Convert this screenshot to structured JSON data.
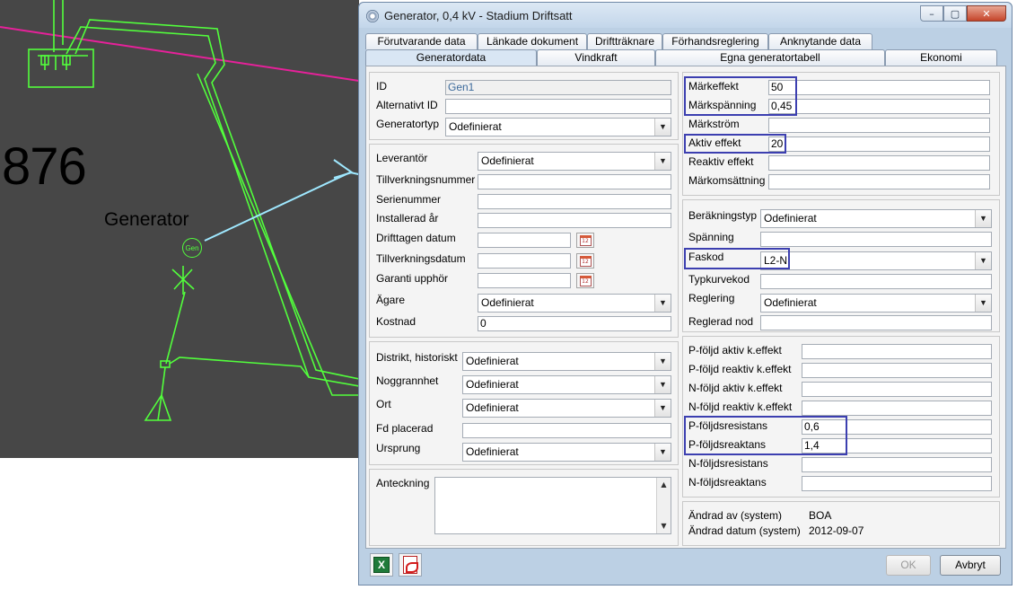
{
  "cad": {
    "number": "876",
    "generator_label": "Generator",
    "gen_symbol": "Gen"
  },
  "window": {
    "title": "Generator, 0,4 kV - Stadium Driftsatt",
    "buttons": {
      "minimize": "–",
      "maximize": "▢",
      "close": "✕"
    }
  },
  "tabs": {
    "row1": [
      "Förutvarande data",
      "Länkade dokument",
      "Driftträknare",
      "Förhandsreglering",
      "Anknytande data"
    ],
    "row2": [
      "Generatordata",
      "Vindkraft",
      "Egna generatortabell",
      "Ekonomi"
    ]
  },
  "ident": {
    "id_label": "ID",
    "id_value": "Gen1",
    "alt_id_label": "Alternativt ID",
    "alt_id_value": "",
    "type_label": "Generatortyp",
    "type_value": "Odefinierat"
  },
  "supplier": {
    "leverantor_label": "Leverantör",
    "leverantor_value": "Odefinierat",
    "tillv_nr_label": "Tillverkningsnummer",
    "tillv_nr_value": "",
    "serienummer_label": "Serienummer",
    "serienummer_value": "",
    "installerad_label": "Installerad år",
    "installerad_value": "",
    "drifttagen_label": "Drifttagen datum",
    "drifttagen_value": "",
    "tillv_datum_label": "Tillverkningsdatum",
    "tillv_datum_value": "",
    "garanti_label": "Garanti upphör",
    "garanti_value": "",
    "agare_label": "Ägare",
    "agare_value": "Odefinierat",
    "kostnad_label": "Kostnad",
    "kostnad_value": "0",
    "calendar_icon_text": "12"
  },
  "location": {
    "distrikt_label": "Distrikt, historiskt",
    "distrikt_value": "Odefinierat",
    "noggrannhet_label": "Noggrannhet",
    "noggrannhet_value": "Odefinierat",
    "ort_label": "Ort",
    "ort_value": "Odefinierat",
    "fd_placerad_label": "Fd placerad",
    "fd_placerad_value": "",
    "ursprung_label": "Ursprung",
    "ursprung_value": "Odefinierat"
  },
  "notes": {
    "label": "Anteckning",
    "value": ""
  },
  "rating": {
    "markeffekt_label": "Märkeffekt",
    "markeffekt_value": "50",
    "markspanning_label": "Märkspänning",
    "markspanning_value": "0,45",
    "markstrom_label": "Märkström",
    "markstrom_value": "",
    "aktiv_label": "Aktiv effekt",
    "aktiv_value": "20",
    "reaktiv_label": "Reaktiv effekt",
    "reaktiv_value": "",
    "markomsattning_label": "Märkomsättning",
    "markomsattning_value": ""
  },
  "calc": {
    "berakningstyp_label": "Beräkningstyp",
    "berakningstyp_value": "Odefinierat",
    "spanning_label": "Spänning",
    "spanning_value": "",
    "faskod_label": "Faskod",
    "faskod_value": "L2-N",
    "typkurvekod_label": "Typkurvekod",
    "typkurvekod_value": "",
    "reglering_label": "Reglering",
    "reglering_value": "Odefinierat",
    "reglerad_nod_label": "Reglerad nod",
    "reglerad_nod_value": ""
  },
  "sequence": {
    "p_aktiv_label": "P-följd aktiv k.effekt",
    "p_aktiv_value": "",
    "p_reaktiv_label": "P-följd reaktiv k.effekt",
    "p_reaktiv_value": "",
    "n_aktiv_label": "N-följd aktiv k.effekt",
    "n_aktiv_value": "",
    "n_reaktiv_label": "N-följd reaktiv k.effekt",
    "n_reaktiv_value": "",
    "p_res_label": "P-följdsresistans",
    "p_res_value": "0,6",
    "p_reakt_label": "P-följdsreaktans",
    "p_reakt_value": "1,4",
    "n_res_label": "N-följdsresistans",
    "n_res_value": "",
    "n_reakt_label": "N-följdsreaktans",
    "n_reakt_value": ""
  },
  "audit": {
    "andrad_av_label": "Ändrad av (system)",
    "andrad_av_value": "BOA",
    "andrad_datum_label": "Ändrad datum (system)",
    "andrad_datum_value": "2012-09-07"
  },
  "footer": {
    "ok_label": "OK",
    "cancel_label": "Avbryt",
    "excel_icon_text": "X"
  },
  "colors": {
    "cad_bg": "#474747",
    "cad_line": "#52ff3c",
    "cad_magenta": "#e6219a",
    "highlight": "#3c3fb0",
    "window_frame": "#bcd0e4"
  }
}
